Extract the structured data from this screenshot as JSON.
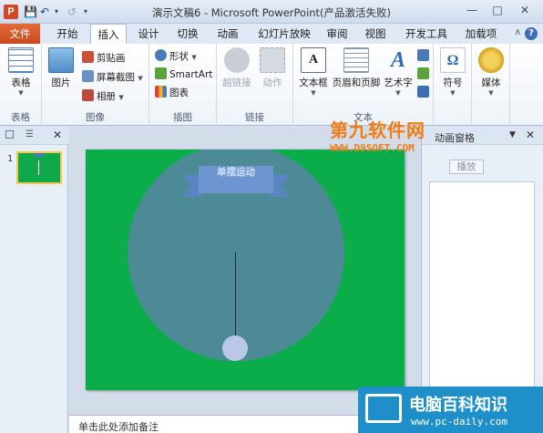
{
  "titlebar": {
    "title": "演示文稿6 - Microsoft PowerPoint(产品激活失败)",
    "app_letter": "P"
  },
  "tabs": {
    "file": "文件",
    "items": [
      "开始",
      "插入",
      "设计",
      "切换",
      "动画",
      "幻灯片放映",
      "审阅",
      "视图",
      "开发工具",
      "加载项"
    ],
    "active": "插入"
  },
  "ribbon": {
    "groups": {
      "table": {
        "label": "表格",
        "button": "表格"
      },
      "image": {
        "label": "图像",
        "picture": "图片",
        "clipart": "剪贴画",
        "screenshot": "屏幕截图",
        "album": "相册"
      },
      "illustration": {
        "label": "插图",
        "shapes": "形状",
        "smartart": "SmartArt",
        "chart": "图表"
      },
      "links": {
        "label": "链接",
        "hyperlink": "超链接",
        "action": "动作"
      },
      "text": {
        "label": "文本",
        "textbox": "文本框",
        "header_footer": "页眉和页脚",
        "wordart": "艺术字"
      },
      "symbol": {
        "label": "符号",
        "button": "符号"
      },
      "media": {
        "label": "媒体",
        "button": "媒体"
      }
    }
  },
  "thumbnails": {
    "slide_number": "1"
  },
  "slide": {
    "banner_text": "单摆运动"
  },
  "notes": {
    "placeholder": "单击此处添加备注"
  },
  "anim_pane": {
    "title": "动画窗格",
    "play_label": "播放"
  },
  "watermarks": {
    "top_cn": "第九软件网",
    "top_url": "WWW.D9SOFT.COM",
    "bottom_cn": "电脑百科知识",
    "bottom_url": "www.pc-daily.com"
  }
}
